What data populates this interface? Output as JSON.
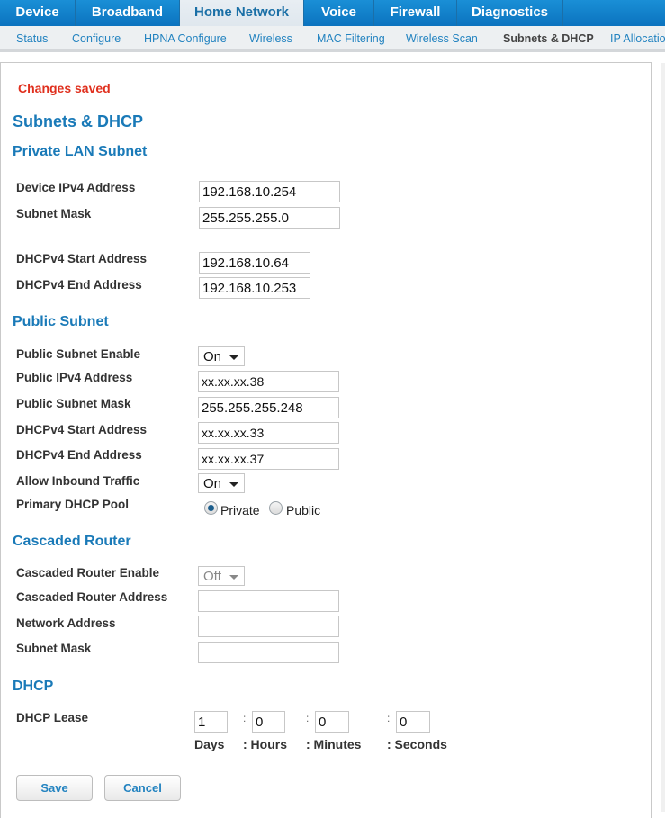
{
  "top_tabs": [
    {
      "label": "Device",
      "active": false
    },
    {
      "label": "Broadband",
      "active": false
    },
    {
      "label": "Home Network",
      "active": true
    },
    {
      "label": "Voice",
      "active": false
    },
    {
      "label": "Firewall",
      "active": false
    },
    {
      "label": "Diagnostics",
      "active": false
    }
  ],
  "sub_tabs": [
    {
      "label": "Status",
      "active": false
    },
    {
      "label": "Configure",
      "active": false
    },
    {
      "label": "HPNA Configure",
      "active": false
    },
    {
      "label": "Wireless",
      "active": false
    },
    {
      "label": "MAC Filtering",
      "active": false
    },
    {
      "label": "Wireless Scan",
      "active": false
    },
    {
      "label": "Subnets & DHCP",
      "active": true
    },
    {
      "label": "IP Allocation",
      "active": false
    }
  ],
  "status_message": "Changes saved",
  "page_title": "Subnets & DHCP",
  "private_lan": {
    "heading": "Private LAN Subnet",
    "device_ipv4_label": "Device IPv4 Address",
    "device_ipv4_value": "192.168.10.254",
    "subnet_mask_label": "Subnet Mask",
    "subnet_mask_value": "255.255.255.0",
    "dhcp_start_label": "DHCPv4 Start Address",
    "dhcp_start_value": "192.168.10.64",
    "dhcp_end_label": "DHCPv4 End Address",
    "dhcp_end_value": "192.168.10.253"
  },
  "public_subnet": {
    "heading": "Public Subnet",
    "enable_label": "Public Subnet Enable",
    "enable_value": "On",
    "ipv4_label": "Public IPv4 Address",
    "ipv4_value": "xx.xx.xx.38",
    "mask_label": "Public Subnet Mask",
    "mask_value": "255.255.255.248",
    "dhcp_start_label": "DHCPv4 Start Address",
    "dhcp_start_value": "xx.xx.xx.33",
    "dhcp_end_label": "DHCPv4 End Address",
    "dhcp_end_value": "xx.xx.xx.37",
    "inbound_label": "Allow Inbound Traffic",
    "inbound_value": "On",
    "pool_label": "Primary DHCP Pool",
    "pool_options": [
      "Private",
      "Public"
    ],
    "pool_selected": "Private"
  },
  "cascaded_router": {
    "heading": "Cascaded Router",
    "enable_label": "Cascaded Router Enable",
    "enable_value": "Off",
    "address_label": "Cascaded Router Address",
    "address_value": "",
    "network_label": "Network Address",
    "network_value": "",
    "mask_label": "Subnet Mask",
    "mask_value": ""
  },
  "dhcp": {
    "heading": "DHCP",
    "lease_label": "DHCP Lease",
    "days": "1",
    "hours": "0",
    "minutes": "0",
    "seconds": "0",
    "colon": ":",
    "units": {
      "days": "Days",
      "hours": ": Hours",
      "minutes": ": Minutes",
      "seconds": ": Seconds"
    }
  },
  "buttons": {
    "save": "Save",
    "cancel": "Cancel"
  }
}
